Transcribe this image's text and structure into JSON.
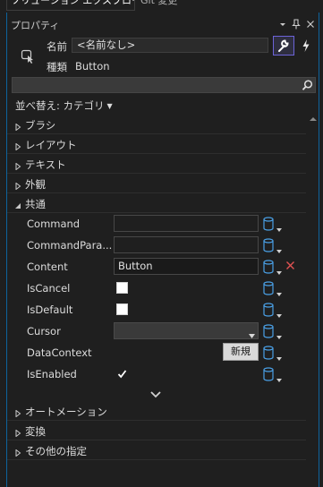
{
  "tabs": {
    "active": "ソリューション エクスプローラー",
    "other": "Git 変更"
  },
  "panel": {
    "title": "プロパティ",
    "menu_glyph": "▾",
    "pin_glyph": "📌",
    "close_glyph": "✕"
  },
  "object": {
    "name_label": "名前",
    "name_value": "<名前なし>",
    "type_label": "種類",
    "type_value": "Button"
  },
  "sort": {
    "label": "並べ替え: カテゴリ"
  },
  "categories_top": [
    {
      "label": "ブラシ",
      "expanded": false
    },
    {
      "label": "レイアウト",
      "expanded": false
    },
    {
      "label": "テキスト",
      "expanded": false
    },
    {
      "label": "外観",
      "expanded": false
    },
    {
      "label": "共通",
      "expanded": true
    }
  ],
  "properties": [
    {
      "name": "Command",
      "kind": "text",
      "value": ""
    },
    {
      "name": "CommandPara...",
      "kind": "text",
      "value": ""
    },
    {
      "name": "Content",
      "kind": "text",
      "value": "Button",
      "reset": true
    },
    {
      "name": "IsCancel",
      "kind": "checkbox",
      "checked": false
    },
    {
      "name": "IsDefault",
      "kind": "checkbox",
      "checked": false
    },
    {
      "name": "Cursor",
      "kind": "combo",
      "value": ""
    },
    {
      "name": "DataContext",
      "kind": "button",
      "button_label": "新規"
    },
    {
      "name": "IsEnabled",
      "kind": "checkbox",
      "checked": true
    }
  ],
  "categories_bottom": [
    {
      "label": "オートメーション",
      "expanded": false
    },
    {
      "label": "変換",
      "expanded": false
    },
    {
      "label": "その他の指定",
      "expanded": false
    }
  ],
  "colors": {
    "accent": "#6c63d8",
    "db_icon": "#4aa0e6",
    "reset": "#e05252",
    "panel_bg": "#1f1f1f"
  }
}
